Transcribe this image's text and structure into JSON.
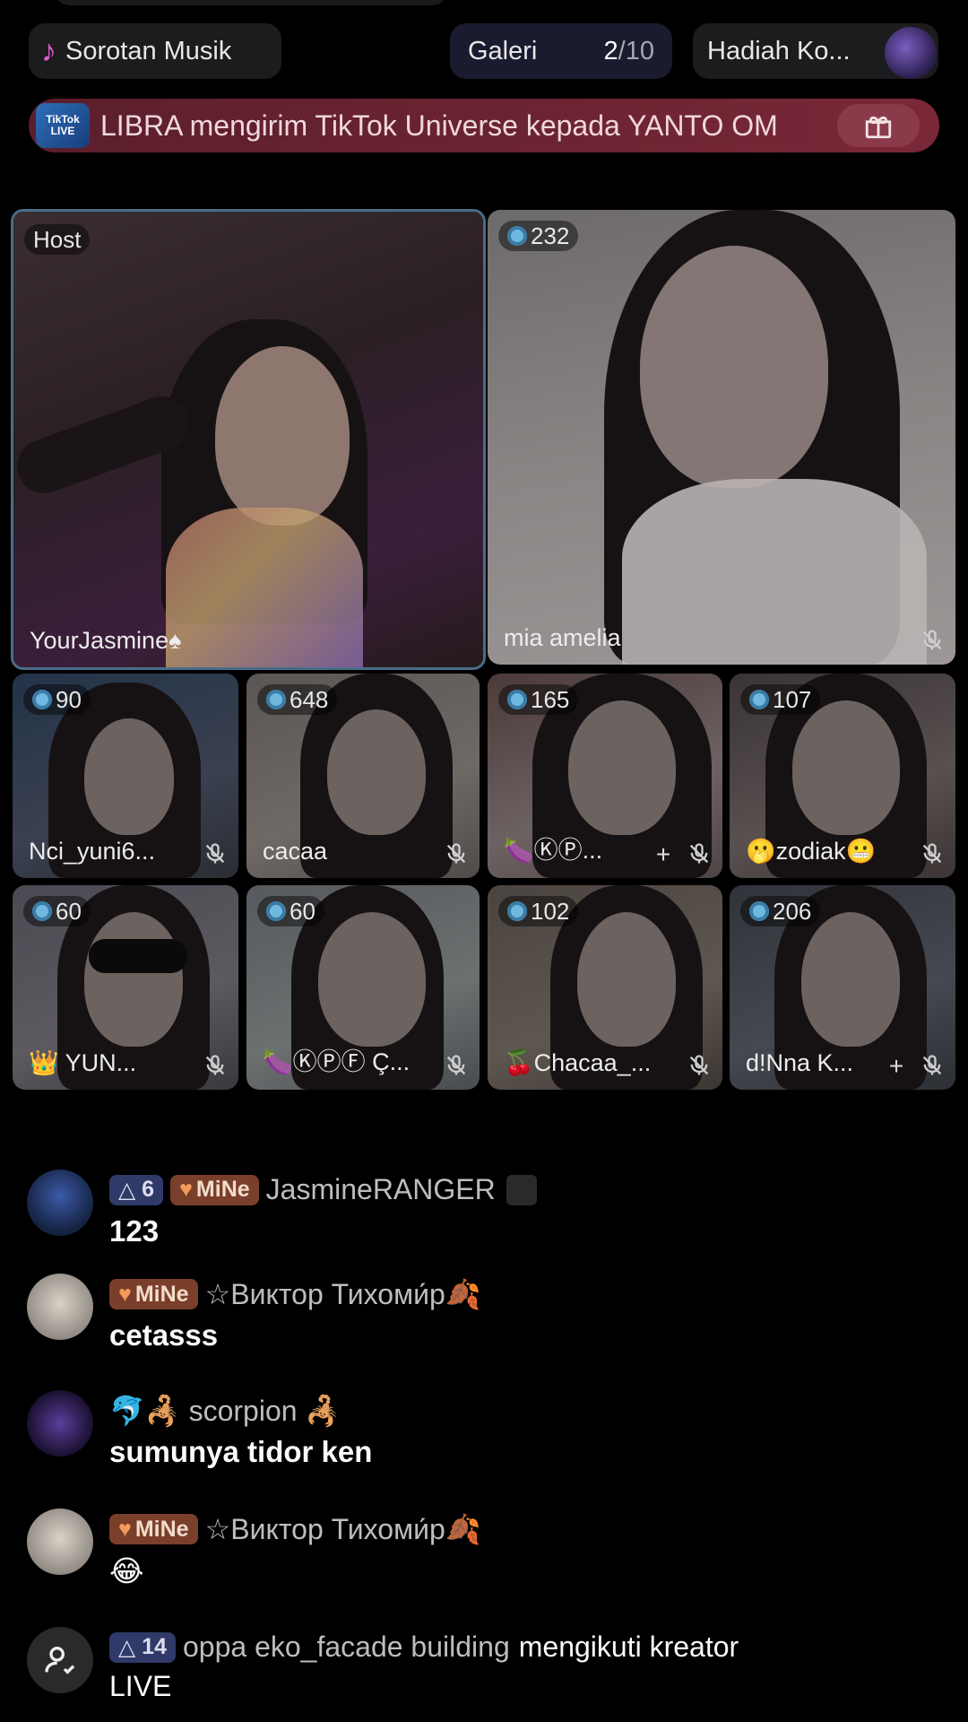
{
  "top": {
    "music_label": "Sorotan Musik",
    "gallery_label": "Galeri",
    "gallery_current": "2",
    "gallery_total": "/10",
    "gift_label": "Hadiah Ko..."
  },
  "banner": {
    "logo_text": "TikTok LIVE",
    "text": "LIBRA mengirim TikTok Universe kepada YANTO OM"
  },
  "host": {
    "badge": "Host",
    "name": "YourJasmine♠"
  },
  "guest_main": {
    "score": "232",
    "name": "mia amelia"
  },
  "guests": [
    {
      "score": "90",
      "name": "Nci_yuni6..."
    },
    {
      "score": "648",
      "name": "cacaa"
    },
    {
      "score": "165",
      "name": "🍆ⓀⓅ..."
    },
    {
      "score": "107",
      "name": "🫢zodiak😬"
    },
    {
      "score": "60",
      "name": "👑 YUN..."
    },
    {
      "score": "60",
      "name": "🍆ⓀⓅⒻ Ç..."
    },
    {
      "score": "102",
      "name": "🍒Chacaa_..."
    },
    {
      "score": "206",
      "name": "d!Nna K..."
    }
  ],
  "comments": [
    {
      "level": "6",
      "mine": "MiNe",
      "user": "JasmineRANGER",
      "text": "123"
    },
    {
      "mine": "MiNe",
      "user": "☆Виктор Тихоми́р🍂",
      "text": "cetasss"
    },
    {
      "user": "🐬🦂 scorpion 🦂",
      "text": "sumunya tidor ken"
    },
    {
      "mine": "MiNe",
      "user": "☆Виктор Тихоми́р🍂",
      "text": "😂"
    }
  ],
  "follow": {
    "level": "14",
    "user": "oppa eko_facade building",
    "action": "mengikuti kreator",
    "live": "LIVE"
  },
  "colors": {
    "accent_music": "#e25ccf",
    "gem": "#6fb8e0",
    "banner": "#6d2432"
  }
}
